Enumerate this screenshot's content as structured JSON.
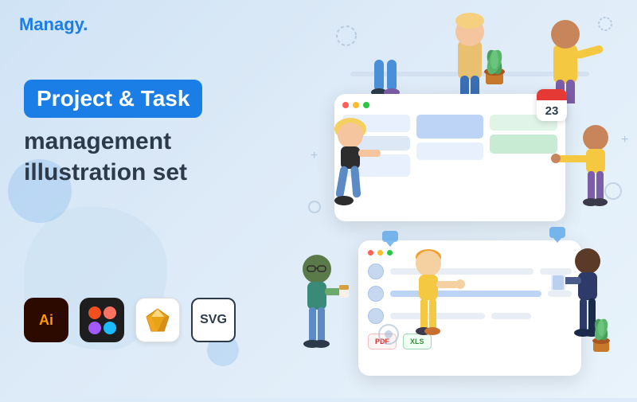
{
  "logo": {
    "text": "Managy."
  },
  "hero": {
    "badge_text": "Project & Task",
    "subtitle_line1": "management",
    "subtitle_line2": "illustration set"
  },
  "formats": [
    {
      "id": "ai",
      "label": "Ai",
      "sublabel": ""
    },
    {
      "id": "figma",
      "label": "Figma"
    },
    {
      "id": "sketch",
      "label": "Sketch"
    },
    {
      "id": "svg",
      "label": "SVG"
    }
  ],
  "kanban": {
    "calendar_num": "23"
  },
  "colors": {
    "brand_blue": "#1a7ee6",
    "bg": "#ddeaf7",
    "dark_text": "#2d3a4a"
  }
}
